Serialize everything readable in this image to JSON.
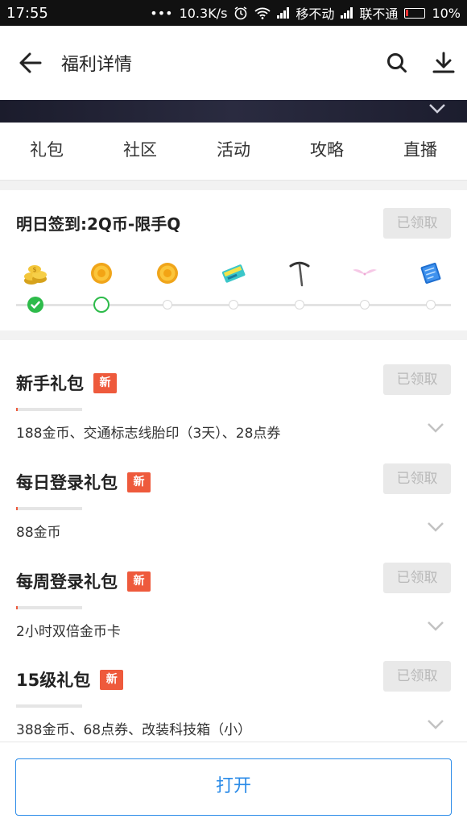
{
  "status_bar": {
    "time": "17:55",
    "dots": "•••",
    "speed": "10.3K/s",
    "carrier1": "移不动",
    "carrier2": "联不通",
    "battery": "10%"
  },
  "header": {
    "title": "福利详情",
    "back_icon": "arrow-left-icon",
    "search_icon": "search-icon",
    "download_icon": "download-icon"
  },
  "tabs": [
    {
      "label": "礼包",
      "active": true
    },
    {
      "label": "社区",
      "active": false
    },
    {
      "label": "活动",
      "active": false
    },
    {
      "label": "攻略",
      "active": false
    },
    {
      "label": "直播",
      "active": false
    }
  ],
  "signin": {
    "title": "明日签到:2Q币-限手Q",
    "button": "已领取",
    "days_completed": 1,
    "current_day": 2,
    "total_days": 7,
    "prizes": [
      "gold-coins-icon",
      "gold-coin-icon",
      "gold-coin-icon",
      "ticket-card-icon",
      "pickaxe-icon",
      "pink-wings-icon",
      "blue-box-icon"
    ]
  },
  "gifts": [
    {
      "name": "新手礼包",
      "badge": "新",
      "button": "已领取",
      "progress": 0.02,
      "desc": "188金币、交通标志线胎印（3天）、28点券"
    },
    {
      "name": "每日登录礼包",
      "badge": "新",
      "button": "已领取",
      "progress": 0.02,
      "desc": "88金币"
    },
    {
      "name": "每周登录礼包",
      "badge": "新",
      "button": "已领取",
      "progress": 0.02,
      "desc": "2小时双倍金币卡"
    },
    {
      "name": "15级礼包",
      "badge": "新",
      "button": "已领取",
      "progress": 0.0,
      "desc": "388金币、68点券、改装科技箱（小）"
    }
  ],
  "footer": {
    "open_button": "打开"
  },
  "colors": {
    "accent": "#2b8be8",
    "badge": "#ee5a3c",
    "done": "#2dbb4a"
  }
}
